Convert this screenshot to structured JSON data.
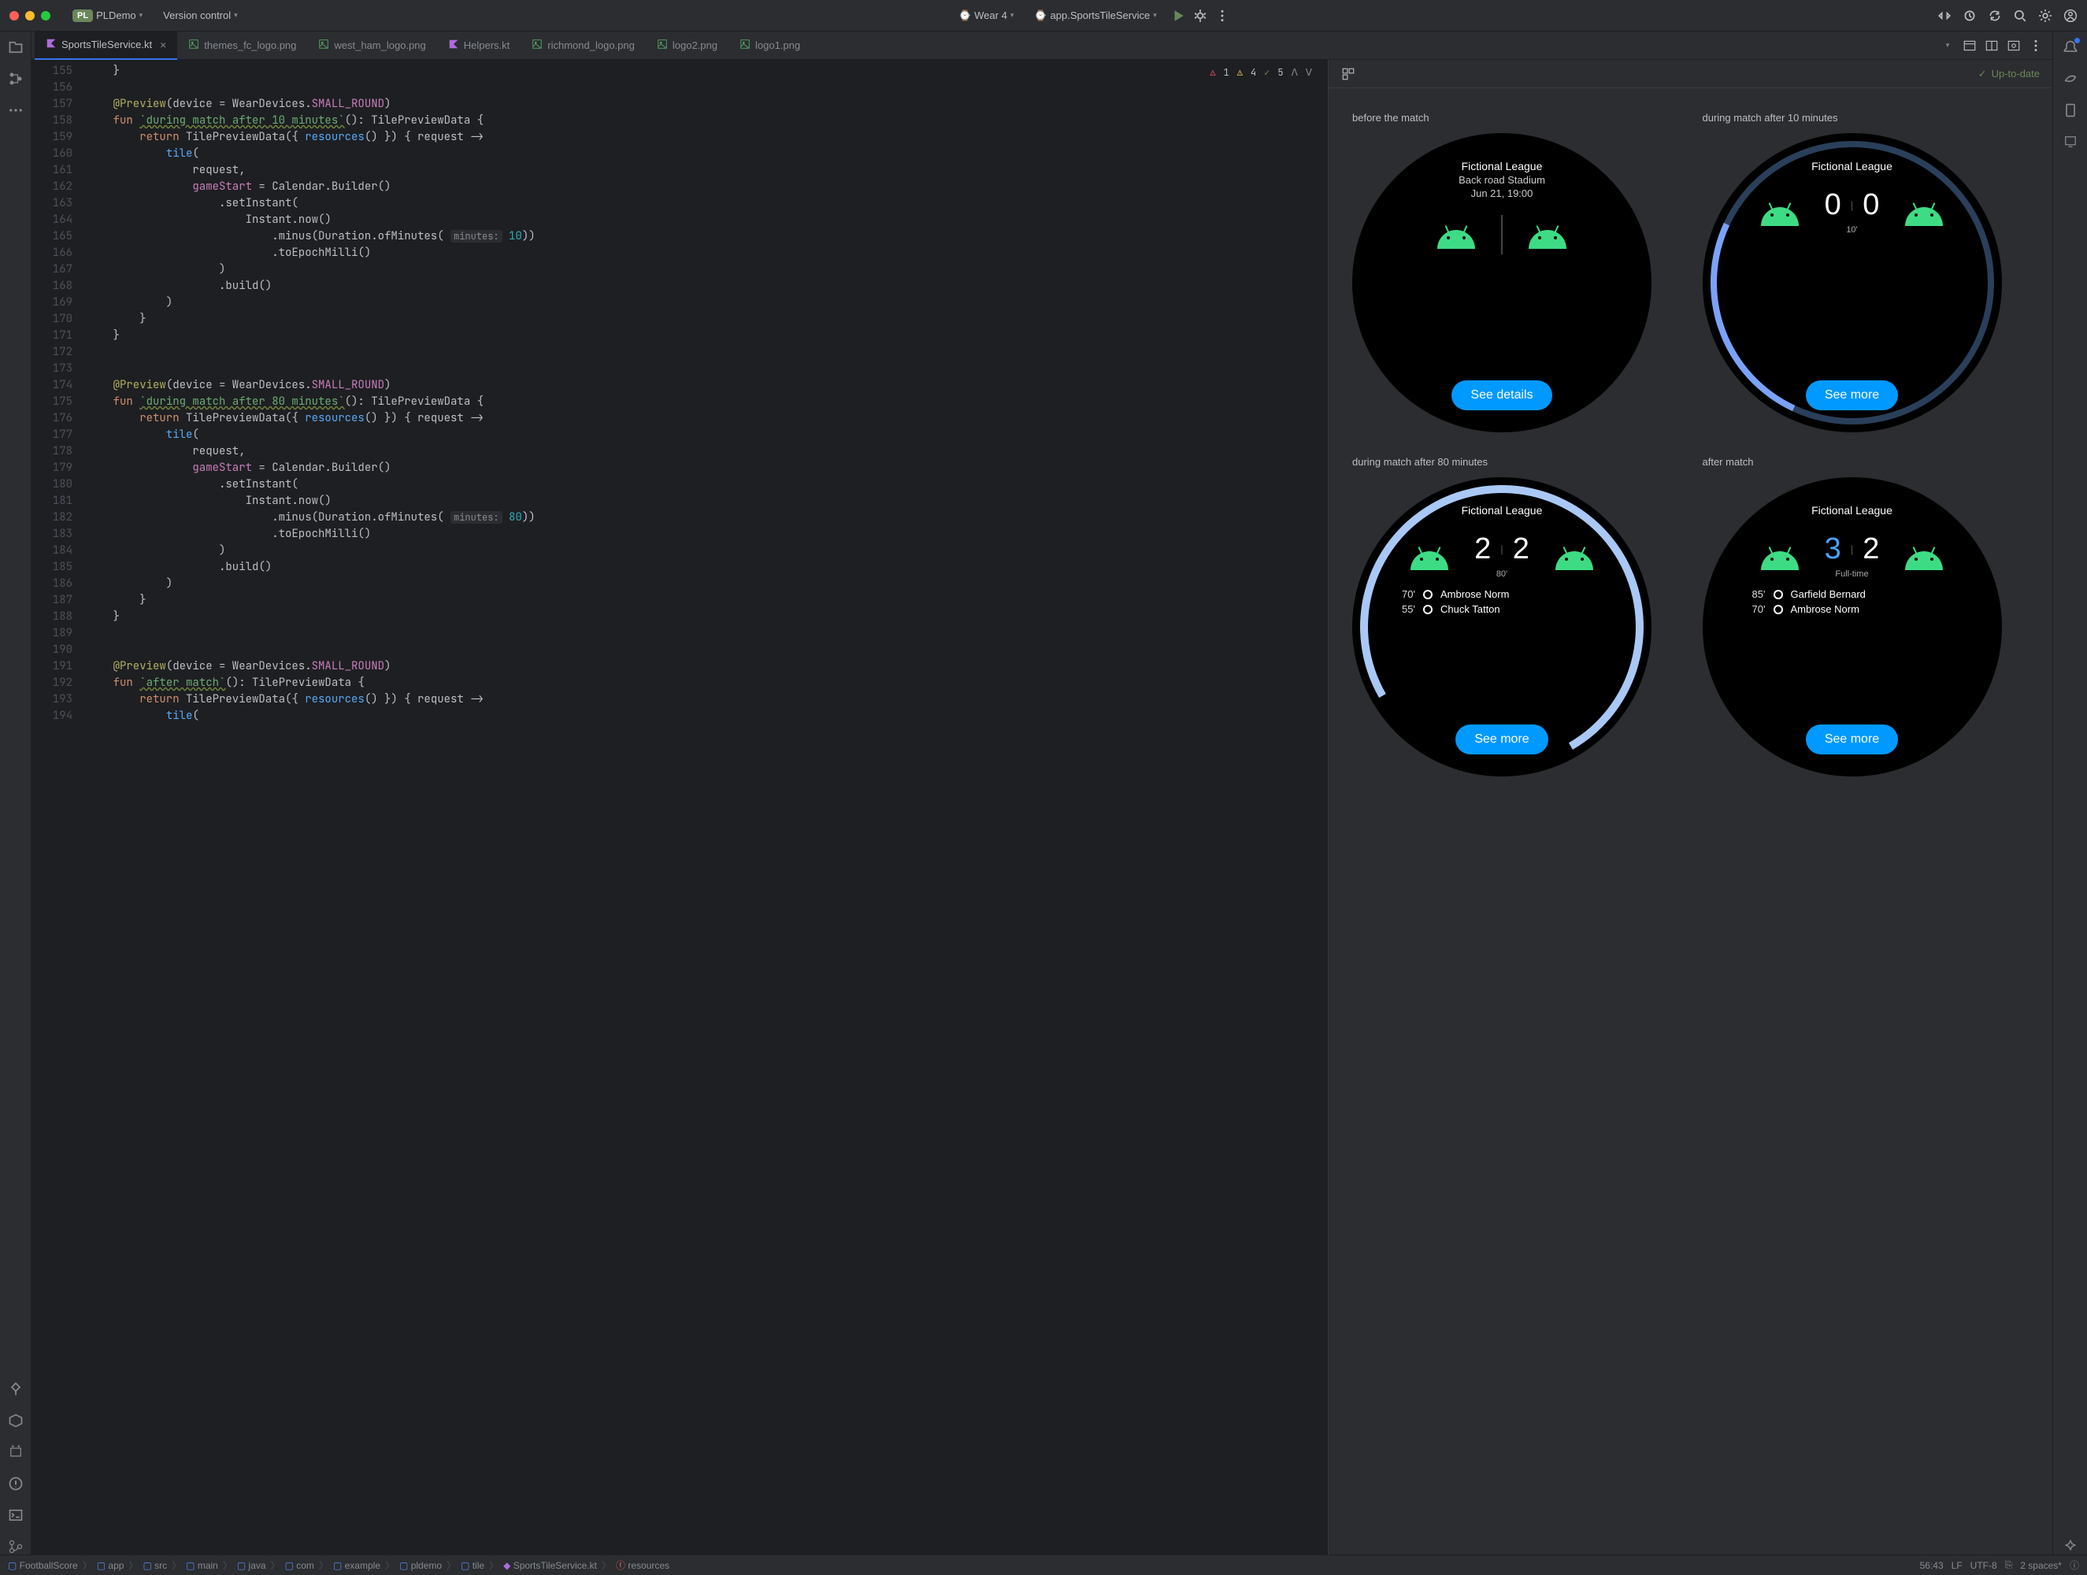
{
  "titlebar": {
    "project_badge": "PL",
    "project_name": "PLDemo",
    "vcs": "Version control",
    "device": "Wear 4",
    "run_config": "app.SportsTileService"
  },
  "tabs": [
    {
      "label": "SportsTileService.kt",
      "type": "kt",
      "active": true
    },
    {
      "label": "themes_fc_logo.png",
      "type": "img"
    },
    {
      "label": "west_ham_logo.png",
      "type": "img"
    },
    {
      "label": "Helpers.kt",
      "type": "kt"
    },
    {
      "label": "richmond_logo.png",
      "type": "img"
    },
    {
      "label": "logo2.png",
      "type": "img"
    },
    {
      "label": "logo1.png",
      "type": "img"
    }
  ],
  "inspection": {
    "errors": "1",
    "warnings": "4",
    "weak": "5"
  },
  "gutter_start": 155,
  "gutter_end": 194,
  "preview": {
    "status": "Up-to-date",
    "cells": [
      {
        "title": "before the match",
        "league": "Fictional League",
        "stadium": "Back road Stadium",
        "date": "Jun 21, 19:00",
        "button": "See details"
      },
      {
        "title": "during match after 10 minutes",
        "league": "Fictional League",
        "score_home": "0",
        "score_away": "0",
        "minute": "10'",
        "button": "See more"
      },
      {
        "title": "during match after 80 minutes",
        "league": "Fictional League",
        "score_home": "2",
        "score_away": "2",
        "minute": "80'",
        "button": "See more",
        "events": [
          {
            "t": "70'",
            "p": "Ambrose Norm"
          },
          {
            "t": "55'",
            "p": "Chuck Tatton"
          }
        ]
      },
      {
        "title": "after match",
        "league": "Fictional League",
        "score_home": "3",
        "score_away": "2",
        "minute": "Full-time",
        "button": "See more",
        "home_blue": true,
        "events": [
          {
            "t": "85'",
            "p": "Garfield Bernard"
          },
          {
            "t": "70'",
            "p": "Ambrose Norm"
          }
        ]
      }
    ]
  },
  "breadcrumbs": [
    "FootballScore",
    "app",
    "src",
    "main",
    "java",
    "com",
    "example",
    "pldemo",
    "tile",
    "SportsTileService.kt",
    "resources"
  ],
  "statusbar": {
    "pos": "56:43",
    "le": "LF",
    "enc": "UTF-8",
    "indent": "2 spaces*"
  }
}
